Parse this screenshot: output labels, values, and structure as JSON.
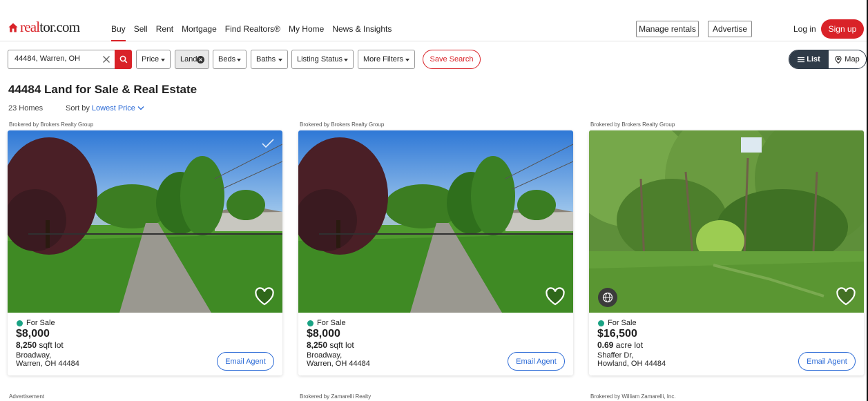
{
  "header": {
    "logo": "realtor.com",
    "nav": [
      "Buy",
      "Sell",
      "Rent",
      "Mortgage",
      "Find Realtors®",
      "My Home",
      "News & Insights"
    ],
    "manage_rentals": "Manage rentals",
    "advertise": "Advertise",
    "login": "Log in",
    "signup": "Sign up"
  },
  "filters": {
    "search_value": "44484, Warren, OH",
    "price": "Price",
    "land": "Land",
    "beds": "Beds",
    "baths": "Baths",
    "listing_status": "Listing Status",
    "more_filters": "More Filters",
    "save_search": "Save Search",
    "view_list": "List",
    "view_map": "Map"
  },
  "results": {
    "title": "44484 Land for Sale & Real Estate",
    "count": "23 Homes",
    "sort_label": "Sort by",
    "sort_value": "Lowest Price"
  },
  "listings": [
    {
      "broker": "Brokered by Brokers Realty Group",
      "status": "For Sale",
      "price": "$8,000",
      "lot_value": "8,250",
      "lot_unit": "sqft lot",
      "street": "Broadway,",
      "city": "Warren, OH 44484",
      "cta": "Email Agent"
    },
    {
      "broker": "Brokered by Brokers Realty Group",
      "status": "For Sale",
      "price": "$8,000",
      "lot_value": "8,250",
      "lot_unit": "sqft lot",
      "street": "Broadway,",
      "city": "Warren, OH 44484",
      "cta": "Email Agent"
    },
    {
      "broker": "Brokered by Brokers Realty Group",
      "status": "For Sale",
      "price": "$16,500",
      "lot_value": "0.69",
      "lot_unit": "acre lot",
      "street": "Shaffer Dr,",
      "city": "Howland, OH 44484",
      "cta": "Email Agent"
    }
  ],
  "below": [
    "Advertisement",
    "Brokered by Zamarelli Realty",
    "Brokered by William Zamarelli, Inc."
  ],
  "colors": {
    "brand_red": "#d92228",
    "link_blue": "#2b6ad6",
    "status_green": "#1aa384",
    "toggle_dark": "#2f3b48"
  },
  "icons": [
    "house-logo-icon",
    "clear-icon",
    "search-icon",
    "caret-down-icon",
    "remove-filter-icon",
    "list-icon",
    "map-pin-icon",
    "chevron-down-icon",
    "heart-icon",
    "checkmark-icon",
    "3d-tour-icon"
  ]
}
